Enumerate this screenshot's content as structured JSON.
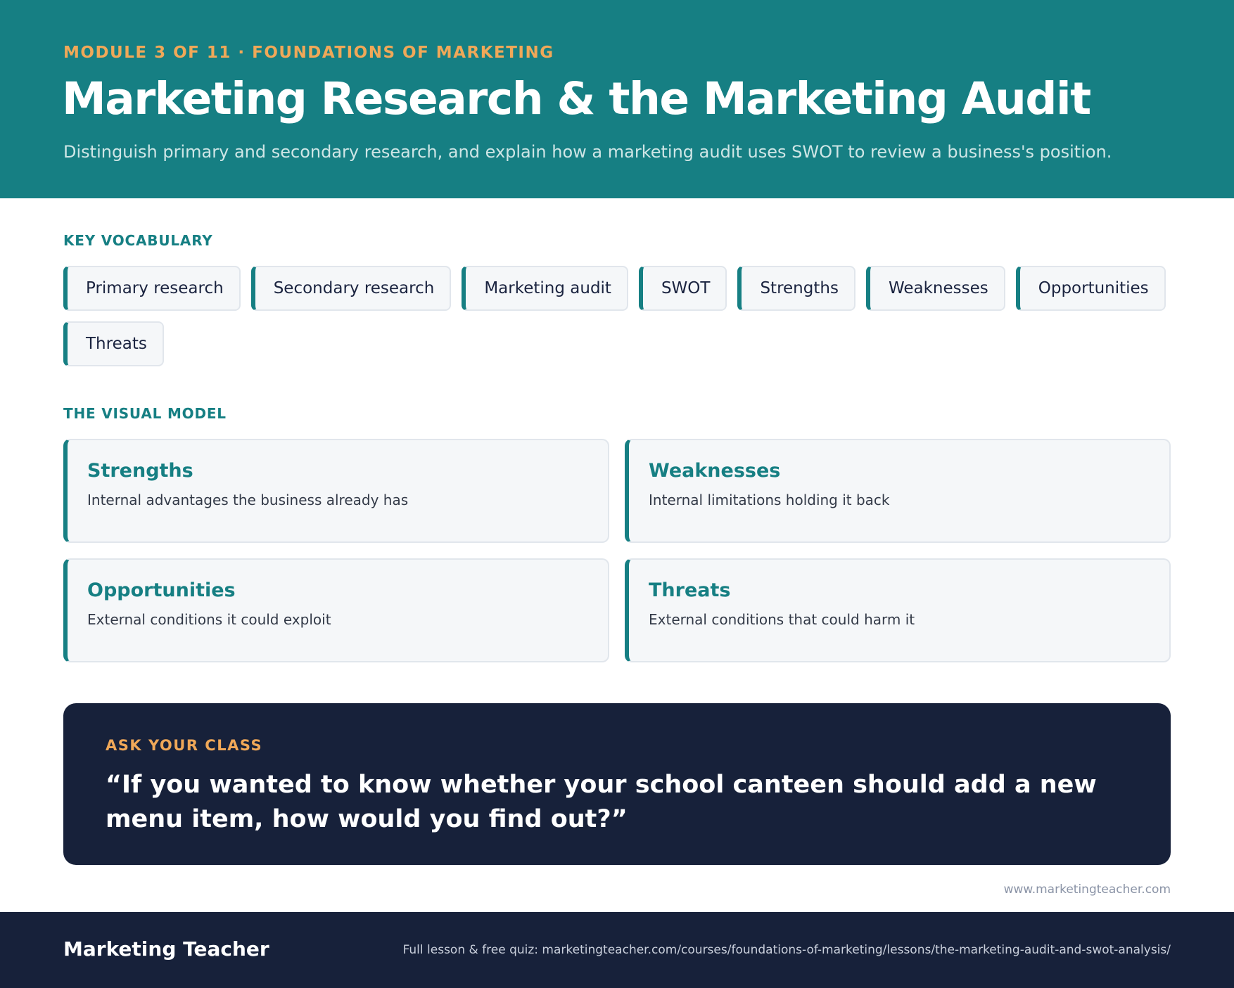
{
  "header": {
    "eyebrow": "MODULE 3 OF 11 · FOUNDATIONS OF MARKETING",
    "title": "Marketing Research & the Marketing Audit",
    "subtitle": "Distinguish primary and secondary research, and explain how a marketing audit uses SWOT to review a business's position."
  },
  "vocabulary": {
    "label": "KEY VOCABULARY",
    "terms": [
      "Primary research",
      "Secondary research",
      "Marketing audit",
      "SWOT",
      "Strengths",
      "Weaknesses",
      "Opportunities",
      "Threats"
    ]
  },
  "visual_model": {
    "label": "THE VISUAL MODEL",
    "quadrants": [
      {
        "title": "Strengths",
        "description": "Internal advantages the business already has"
      },
      {
        "title": "Weaknesses",
        "description": "Internal limitations holding it back"
      },
      {
        "title": "Opportunities",
        "description": "External conditions it could exploit"
      },
      {
        "title": "Threats",
        "description": "External conditions that could harm it"
      }
    ]
  },
  "ask_your_class": {
    "label": "ASK YOUR CLASS",
    "question": "“If you wanted to know whether your school canteen should add a new menu item, how would you find out?”"
  },
  "website": "www.marketingteacher.com",
  "footer": {
    "brand": "Marketing Teacher",
    "link_text": "Full lesson & free quiz: marketingteacher.com/courses/foundations-of-marketing/lessons/the-marketing-audit-and-swot-analysis/"
  },
  "colors": {
    "teal": "#167f83",
    "navy": "#17213a",
    "orange": "#f0a858",
    "card_bg": "#f5f7f9"
  }
}
